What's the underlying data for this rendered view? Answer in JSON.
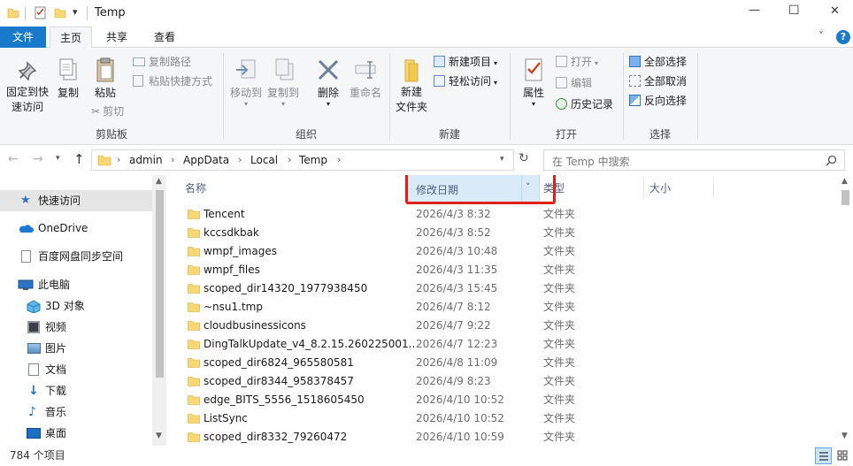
{
  "window": {
    "title": "Temp",
    "minimize_glyph": "—",
    "maximize_glyph": "☐",
    "close_glyph": "✕",
    "help_glyph": "?",
    "collapse_glyph": "˅"
  },
  "tabs": [
    {
      "label": "文件"
    },
    {
      "label": "主页"
    },
    {
      "label": "共享"
    },
    {
      "label": "查看"
    }
  ],
  "ribbon": {
    "clipboard": {
      "pin_label_1": "固定到快",
      "pin_label_2": "速访问",
      "copy_label": "复制",
      "paste_label": "粘贴",
      "copy_path_label": "复制路径",
      "paste_shortcut_label": "粘贴快捷方式",
      "cut_label": "剪切",
      "group_label": "剪贴板"
    },
    "organize": {
      "move_to_label": "移动到",
      "copy_to_label": "复制到",
      "delete_label": "删除",
      "rename_label": "重命名",
      "group_label": "组织"
    },
    "new": {
      "new_folder_label_1": "新建",
      "new_folder_label_2": "文件夹",
      "new_item_label": "新建项目",
      "easy_access_label": "轻松访问",
      "group_label": "新建"
    },
    "open": {
      "properties_label": "属性",
      "open_label": "打开",
      "edit_label": "编辑",
      "history_label": "历史记录",
      "group_label": "打开"
    },
    "select": {
      "select_all_label": "全部选择",
      "select_none_label": "全部取消",
      "invert_label": "反向选择",
      "group_label": "选择"
    }
  },
  "address": {
    "crumbs": [
      "admin",
      "AppData",
      "Local",
      "Temp"
    ],
    "search_placeholder": "在 Temp 中搜索"
  },
  "nav": {
    "items": [
      {
        "label": "快速访问",
        "icon": "star-icon"
      },
      {
        "label": "OneDrive",
        "icon": "cloud-icon"
      },
      {
        "label": "百度网盘同步空间",
        "icon": "document-icon"
      },
      {
        "label": "此电脑",
        "icon": "computer-icon"
      },
      {
        "label": "3D 对象",
        "icon": "cube-icon"
      },
      {
        "label": "视频",
        "icon": "video-icon"
      },
      {
        "label": "图片",
        "icon": "picture-icon"
      },
      {
        "label": "文档",
        "icon": "document-icon"
      },
      {
        "label": "下载",
        "icon": "download-icon"
      },
      {
        "label": "音乐",
        "icon": "music-icon"
      },
      {
        "label": "桌面",
        "icon": "desktop-icon"
      }
    ]
  },
  "columns": {
    "name": "名称",
    "date": "修改日期",
    "type": "类型",
    "size": "大小"
  },
  "files": [
    {
      "name": "Tencent",
      "date": "2026/4/3 8:32",
      "type": "文件夹"
    },
    {
      "name": "kccsdkbak",
      "date": "2026/4/3 8:52",
      "type": "文件夹"
    },
    {
      "name": "wmpf_images",
      "date": "2026/4/3 10:48",
      "type": "文件夹"
    },
    {
      "name": "wmpf_files",
      "date": "2026/4/3 11:35",
      "type": "文件夹"
    },
    {
      "name": "scoped_dir14320_1977938450",
      "date": "2026/4/3 15:45",
      "type": "文件夹"
    },
    {
      "name": "~nsu1.tmp",
      "date": "2026/4/7 8:12",
      "type": "文件夹"
    },
    {
      "name": "cloudbusinessicons",
      "date": "2026/4/7 9:22",
      "type": "文件夹"
    },
    {
      "name": "DingTalkUpdate_v4_8.2.15.260225001...",
      "date": "2026/4/7 12:23",
      "type": "文件夹"
    },
    {
      "name": "scoped_dir6824_965580581",
      "date": "2026/4/8 11:09",
      "type": "文件夹"
    },
    {
      "name": "scoped_dir8344_958378457",
      "date": "2026/4/9 8:23",
      "type": "文件夹"
    },
    {
      "name": "edge_BITS_5556_1518605450",
      "date": "2026/4/10 10:52",
      "type": "文件夹"
    },
    {
      "name": "ListSync",
      "date": "2026/4/10 10:52",
      "type": "文件夹"
    },
    {
      "name": "scoped_dir8332_79260472",
      "date": "2026/4/10 10:59",
      "type": "文件夹"
    }
  ],
  "status": {
    "count_text": "784 个项目"
  },
  "colors": {
    "accent": "#1979ca",
    "highlight_box": "#e0201b",
    "folder": "#f8d775"
  }
}
